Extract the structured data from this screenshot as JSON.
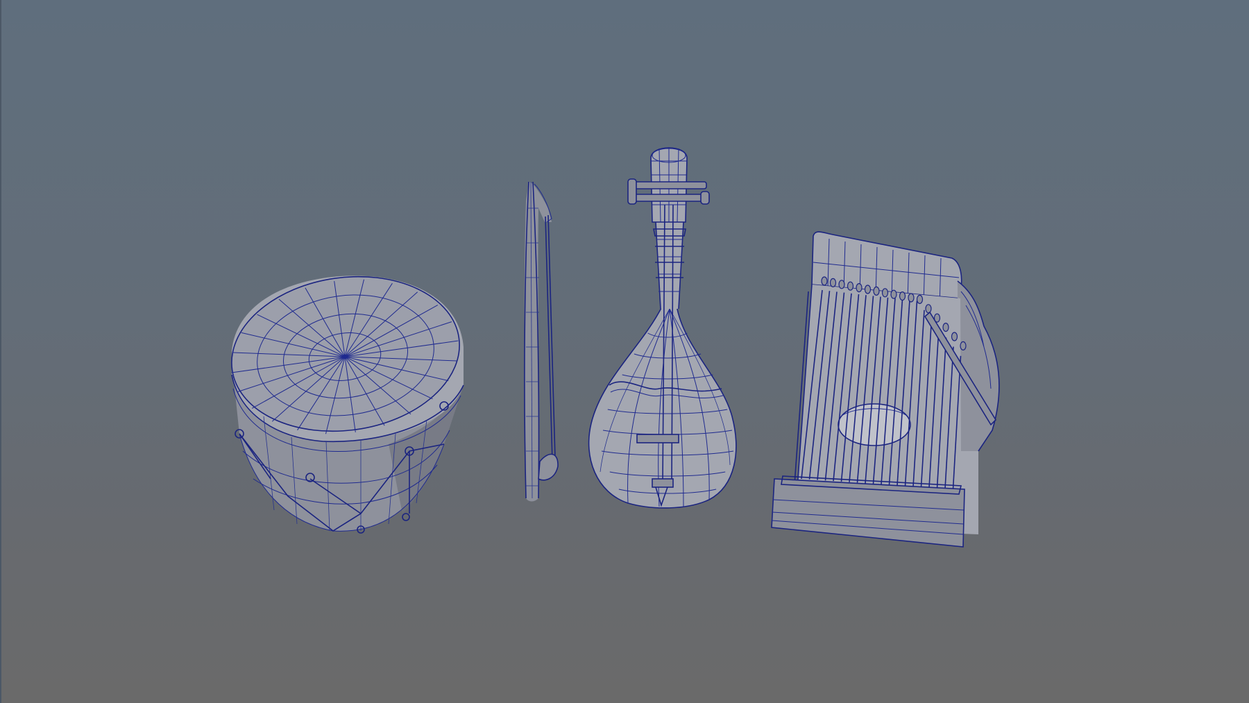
{
  "viewport": {
    "background_top": "#5f6e7d",
    "background_bottom": "#6a6a6a",
    "wire_color": "#1f2a8f",
    "shade_color": "#a4a7b1"
  },
  "objects": [
    {
      "name": "drum",
      "kind": "wireframe-mesh"
    },
    {
      "name": "bow",
      "kind": "wireframe-mesh"
    },
    {
      "name": "lute",
      "kind": "wireframe-mesh"
    },
    {
      "name": "zither",
      "kind": "wireframe-mesh"
    }
  ]
}
